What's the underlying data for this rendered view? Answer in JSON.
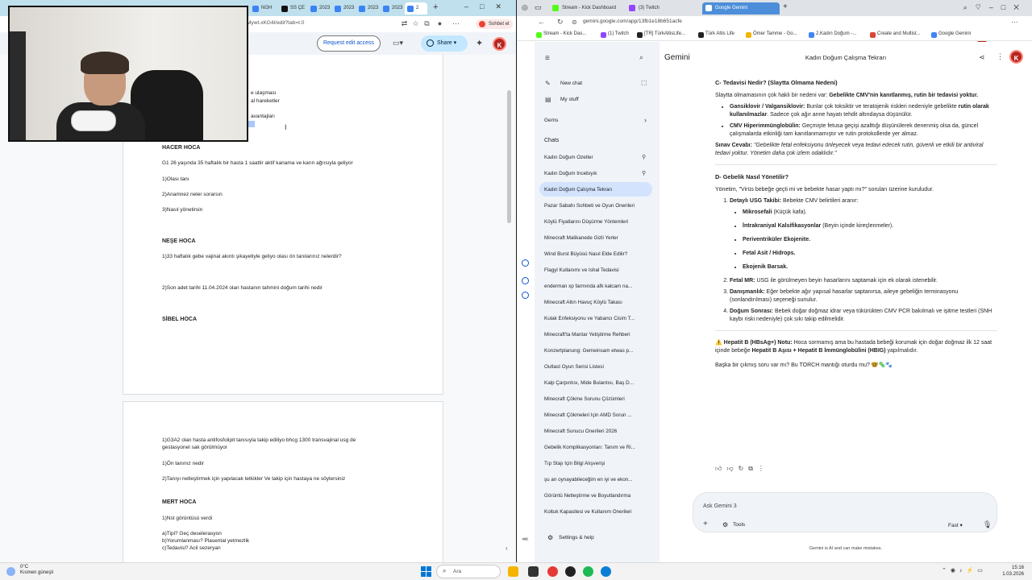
{
  "left_browser": {
    "tabs": [
      "NGH",
      "SS ÇE",
      "2023",
      "2023",
      "2023",
      "2023",
      "2"
    ],
    "chat_pill": "Sohbet et",
    "url": "Mywt-xKG4I/edit?tab=t.0",
    "request_edit": "Request edit access",
    "share": "Share",
    "avatar": "K"
  },
  "doc": {
    "frag1": "e ulaşması",
    "frag2": "al hareketler",
    "frag3": "avantajları",
    "watermark": "karimera",
    "hacer_title": "HACER HOCA",
    "hacer_case": "G1 26 yaşında 35 haftalık bir hasta 1 saattir aktif kanama ve karın ağrısıyla geliyor",
    "hacer_q1": "1)Olası tanı",
    "hacer_q2": "2)Anamnez neler sorarsın",
    "hacer_q3": "3)Nasıl yönetirsin",
    "nese_title": "NEŞE HOCA",
    "nese_q1": "1)33 haftalık gebe vajinal akıntı şikayetiyle geliyo olası ön tanılarınız nelerdir?",
    "nese_q2": "2)Son adet tarihi 11.04.2024 olan hastanın tahmini doğum tarihi nedir",
    "sibel_title": "SİBEL HOCA",
    "p2_line1": "1)G3A2 olan hasta antifosfolipit tanısıyla takip ediliyo bhcg 1300 transvajinal usg de",
    "p2_line2": "gestasyonel sak görülmüyor",
    "p2_q1": "1)Ön tanınız nedir",
    "p2_q2": "2)Tanıyı netleştirmek için yapılacak tetkikler Ve takip için hastaya ne söylersiniz",
    "mert_title": "MERT HOCA",
    "mert_q1": "1)Nst görüntüsü verdi",
    "mert_a": "a)Tipi? Geç deselerasyon",
    "mert_b": "b)Yorumlanması? Plasental yetmezlik",
    "mert_c": "c)Tedavisi? Acil sezeryan"
  },
  "right_browser": {
    "tabs": [
      "Stream - Kick Dashboard",
      "(3) Twitch",
      "Google Gemini"
    ],
    "url": "gemini.google.com/app/13fb1e18b651acfe",
    "ai_label": "AI",
    "avatar": "K",
    "bookmarks": [
      "Stream - Kick Das...",
      "(1) Twitch",
      "[TR] TürkAltisLife...",
      "Türk Altis Life",
      "Ömer Tamme - Go...",
      "2.Kadın Doğum -...",
      "Create and Multist...",
      "Google Gemini"
    ]
  },
  "gemini_side": {
    "new_chat": "New chat",
    "my_stuff": "My stuff",
    "gems": "Gems",
    "chats_label": "Chats",
    "chats": [
      "Kadın Doğum Özetler",
      "Kadın Doğum İncebıyık",
      "Kadın Doğum Çalışma Tekrarı",
      "Pazar Sabahı Sohbeti ve Oyun Önerileri",
      "Köylü Fiyatlarını Düşürme Yöntemleri",
      "Minecraft Malikanede Gizli Yerler",
      "Wind Burst Büyüsü Nasıl Elde Edilir?",
      "Flagyl Kullanımı ve İshal Tedavisi",
      "enderman xp farmında afk kalcam na...",
      "Minecraft Altın Havuç Köylü Takası",
      "Kulak Enfeksiyonu ve Yabancı Cisim T...",
      "Minecraft'ta Mantar Yetiştirme Rehberi",
      "Konzertplanung: Gemeinsam etwas p...",
      "Outlast Oyun Serisi Listesi",
      "Kalp Çarpıntısı, Mide Bulantısı, Baş D...",
      "Minecraft Çökme Sorunu Çözümleri",
      "Minecraft Çökmeleri İçin AMD Sorun ...",
      "Minecraft Sunucu Önerileri 2026",
      "Gebelik Komplikasyonları: Tanım ve Ri...",
      "Tıp Stajı İçin Bilgi Alışverişi",
      "şu an oynayabileceğim en iyi ve ekon...",
      "Görüntü Netleştirme ve Boyutlandırma",
      "Koltuk Kapasitesi ve Kullanım Önerileri"
    ],
    "settings": "Settings & help"
  },
  "gemini_main": {
    "brand": "Gemini",
    "title": "Kadın Doğum Çalışma Tekrarı",
    "c_heading": "C- Tedavisi Nedir? (Slaytta Olmama Nedeni)",
    "c_intro_plain": "Slaytta olmamasının çok haklı bir nedeni var: ",
    "c_intro_bold": "Gebelikte CMV'nin kanıtlanmış, rutin bir tedavisi yoktur.",
    "c_b1_bold": "Gansiklovir / Valgansiklovir:",
    "c_b1_text": " Bunlar çok toksiktir ve teratojenik riskleri nedeniyle gebelikte ",
    "c_b1_bold2": "rutin olarak kullanılmazlar",
    "c_b1_text2": ". Sadece çok ağır anne hayatı tehdit altındaysa düşünülür.",
    "c_b2_bold": "CMV Hiperimmünglobülin:",
    "c_b2_text": " Geçmişte fetusa geçişi azalttığı düşünülerek denenmiş olsa da, güncel çalışmalarda etkinliği tam kanıtlanmamıştır ve rutin protokollerde yer almaz.",
    "exam_bold": "Sınav Cevabı:",
    "exam_text": " \"Gebelikte fetal enfeksiyonu önleyecek veya tedavi edecek rutin, güvenli ve etkili bir antiviral tedavi yoktur. Yönetim daha çok izlem odaklıdır.\"",
    "d_heading": "D- Gebelik Nasıl Yönetilir?",
    "d_intro": "Yönetim, \"Virüs bebeğe geçti mi ve bebekte hasar yaptı mı?\" soruları üzerine kuruludur.",
    "d1_bold": "Detaylı USG Takibi:",
    "d1_text": " Bebekte CMV belirtileri aranır:",
    "d1_sub1_bold": "Mikrosefali",
    "d1_sub1_text": " (Küçük kafa).",
    "d1_sub2_bold": "İntrakraniyal Kalsifikasyonlar",
    "d1_sub2_text": " (Beyin içinde kireçlenmeler).",
    "d1_sub3": "Periventriküler Ekojenite.",
    "d1_sub4": "Fetal Asit / Hidrops.",
    "d1_sub5": "Ekojenik Barsak.",
    "d2_bold": "Fetal MR:",
    "d2_text": " USG ile görülmeyen beyin hasarlarını saptamak için ek olarak istenebilir.",
    "d3_bold": "Danışmanlık:",
    "d3_text": " Eğer bebekte ağır yapısal hasarlar saptanırsa, aileye gebeliğin terminasyonu (sonlandırılması) seçeneği sunulur.",
    "d4_bold": "Doğum Sonrası:",
    "d4_text": " Bebek doğar doğmaz idrar veya tükürükten CMV PCR bakılmalı ve işitme testleri (SNH kaybı riski nedeniyle) çok sıkı takip edilmelidir.",
    "hep_bold": "⚠️ Hepatit B (HBsAg+) Notu:",
    "hep_text": " Hoca sormamış ama bu hastada bebeği korumak için doğar doğmaz ilk 12 saat içinde bebeğe ",
    "hep_bold2": "Hepatit B Aşısı + Hepatit B İmmünglobülini (HBIG)",
    "hep_text2": " yapılmalıdır.",
    "closing": "Başka bir çıkmış soru var mı? Bu TORCH mantığı oturdu mu? 🤓🦠🐾",
    "ask_placeholder": "Ask Gemini 3",
    "tools": "Tools",
    "fast": "Fast",
    "disclaimer": "Gemini is AI and can make mistakes."
  },
  "taskbar": {
    "temp": "0°C",
    "weather": "Kısmen güneşli",
    "search": "Ara",
    "time": "15:16",
    "date": "1.03.2026"
  }
}
